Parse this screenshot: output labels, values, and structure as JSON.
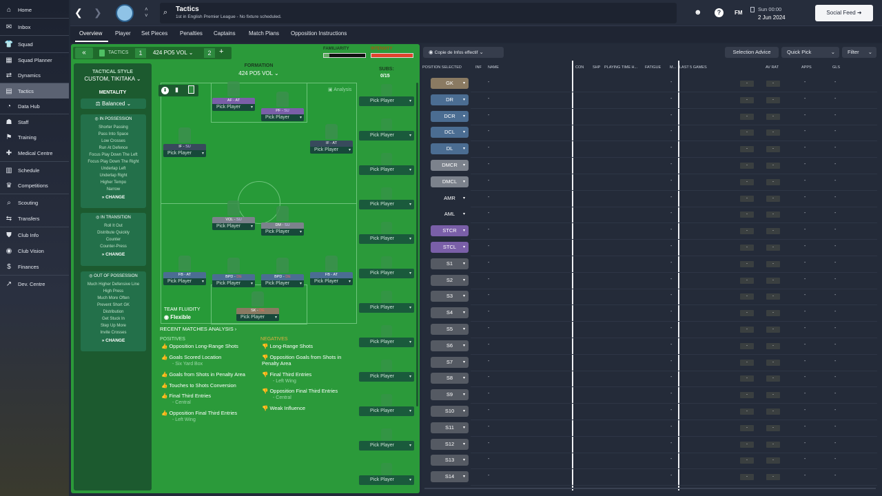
{
  "sidebar": {
    "items": [
      {
        "label": "Home",
        "icon": "home-icon",
        "g": "⌂"
      },
      {
        "label": "Inbox",
        "icon": "inbox-icon",
        "g": "✉",
        "badge": "123"
      },
      {
        "label": "Squad",
        "icon": "squad-icon",
        "g": "👕"
      },
      {
        "label": "Squad Planner",
        "icon": "planner-icon",
        "g": "▦"
      },
      {
        "label": "Dynamics",
        "icon": "dynamics-icon",
        "g": "⇄"
      },
      {
        "label": "Tactics",
        "icon": "tactics-icon",
        "g": "▤",
        "active": true
      },
      {
        "label": "Data Hub",
        "icon": "datahub-icon",
        "g": "◔"
      },
      {
        "label": "Staff",
        "icon": "staff-icon",
        "g": "☗"
      },
      {
        "label": "Training",
        "icon": "training-icon",
        "g": "⚑"
      },
      {
        "label": "Medical Centre",
        "icon": "medical-icon",
        "g": "✚"
      },
      {
        "label": "Schedule",
        "icon": "schedule-icon",
        "g": "▥"
      },
      {
        "label": "Competitions",
        "icon": "trophy-icon",
        "g": "♛"
      },
      {
        "label": "Scouting",
        "icon": "scouting-icon",
        "g": "⌕"
      },
      {
        "label": "Transfers",
        "icon": "transfers-icon",
        "g": "⇆"
      },
      {
        "label": "Club Info",
        "icon": "clubinfo-icon",
        "g": "⛊"
      },
      {
        "label": "Club Vision",
        "icon": "vision-icon",
        "g": "◉"
      },
      {
        "label": "Finances",
        "icon": "finances-icon",
        "g": "$"
      },
      {
        "label": "Dev. Centre",
        "icon": "devcentre-icon",
        "g": "↗"
      }
    ]
  },
  "header": {
    "title": "Tactics",
    "subtitle": "1st in English Premier League - No fixture scheduled.",
    "date_day": "Sun 00:00",
    "date": "2 Jun 2024",
    "social": "Social Feed",
    "fm": "FM"
  },
  "tabs": [
    "Overview",
    "Player",
    "Set Pieces",
    "Penalties",
    "Captains",
    "Match Plans",
    "Opposition Instructions"
  ],
  "tacticbar": {
    "label": "TACTICS",
    "slot1": "1",
    "name": "424 PO5 VOL",
    "slot2": "2",
    "add": "+",
    "familiarity": "FAMILIARITY",
    "intensity": "INTENSITY"
  },
  "style": {
    "heading": "TACTICAL STYLE",
    "value": "CUSTOM, TIKITAKA",
    "mentality_h": "MENTALITY",
    "mentality": "Balanced"
  },
  "in_possession": {
    "title": "IN POSSESSION",
    "items": [
      "Shorter Passing",
      "Pass Into Space",
      "Low Crosses",
      "Run At Defence",
      "Focus Play Down The Left",
      "Focus Play Down The Right",
      "Underlap Left",
      "Underlap Right",
      "Higher Tempo",
      "Narrow"
    ],
    "change": "CHANGE"
  },
  "in_transition": {
    "title": "IN TRANSITION",
    "items": [
      "Roll It Out",
      "Distribute Quickly",
      "Counter",
      "Counter-Press"
    ],
    "change": "CHANGE"
  },
  "out_possession": {
    "title": "OUT OF POSSESSION",
    "items": [
      "Much Higher Defensive Line",
      "High Press",
      "Much More Often",
      "Prevent Short GK",
      "Distribution",
      "Get Stuck In",
      "Step Up More",
      "Invite Crosses"
    ],
    "change": "CHANGE"
  },
  "formation": {
    "label": "FORMATION",
    "name": "424 PO5 VOL",
    "analysis": "Analysis",
    "subs_h": "SUBS:",
    "subs": "0/15"
  },
  "pitch_players": [
    {
      "role": "AF",
      "duty": "AT",
      "pick": "Pick Player",
      "c": "#7a5fa8"
    },
    {
      "role": "PF",
      "duty": "SU",
      "pick": "Pick Player",
      "c": "#7a5fa8"
    },
    {
      "role": "IF",
      "duty": "SU",
      "pick": "Pick Player",
      "c": "#384a5c"
    },
    {
      "role": "IF",
      "duty": "AT",
      "pick": "Pick Player",
      "c": "#384a5c"
    },
    {
      "role": "VOL",
      "duty": "SU",
      "pick": "Pick Player",
      "c": "#7c828c"
    },
    {
      "role": "DM",
      "duty": "SU",
      "pick": "Pick Player",
      "c": "#7c828c"
    },
    {
      "role": "FB",
      "duty": "AT",
      "pick": "Pick Player",
      "c": "#4b6d92"
    },
    {
      "role": "BPD",
      "duty": "DE",
      "pick": "Pick Player",
      "c": "#4b6d92"
    },
    {
      "role": "BPD",
      "duty": "DE",
      "pick": "Pick Player",
      "c": "#4b6d92"
    },
    {
      "role": "FB",
      "duty": "AT",
      "pick": "Pick Player",
      "c": "#4b6d92"
    },
    {
      "role": "SK",
      "duty": "DE",
      "pick": "Pick Player",
      "c": "#8a7a62"
    }
  ],
  "fluidity": {
    "label": "TEAM FLUIDITY",
    "value": "Flexible"
  },
  "sub_pick": "Pick Player",
  "analysis": {
    "title": "RECENT MATCHES ANALYSIS",
    "pos_h": "POSITIVES",
    "neg_h": "NEGATIVES",
    "positives": [
      [
        "Opposition Long-Range Shots",
        ""
      ],
      [
        "Goals Scored Location",
        "- Six Yard Box"
      ],
      [
        "Goals from Shots in Penalty Area",
        ""
      ],
      [
        "Touches to Shots Conversion",
        ""
      ],
      [
        "Final Third Entries",
        "- Central"
      ],
      [
        "Opposition Final Third Entries",
        "- Left Wing"
      ]
    ],
    "negatives": [
      [
        "Long-Range Shots",
        ""
      ],
      [
        "Opposition Goals from Shots in Penalty Area",
        ""
      ],
      [
        "Final Third Entries",
        "- Left Wing"
      ],
      [
        "Opposition Final Third Entries",
        "- Central"
      ],
      [
        "Weak Influence",
        ""
      ]
    ]
  },
  "right": {
    "copy": "Copie de Infos effectif",
    "selection": "Selection Advice",
    "quick": "Quick Pick",
    "filter": "Filter",
    "cols": [
      "POSITION SELECTED",
      "INF",
      "NAME",
      "CON",
      "SHP",
      "PLAYING TIME H...",
      "FATIGUE",
      "M...",
      "LAST 5 GAMES",
      "AV RAT",
      "APPS",
      "GLS"
    ],
    "positions": [
      [
        "GK",
        "#8a7a62"
      ],
      [
        "DR",
        "#4b6d92"
      ],
      [
        "DCR",
        "#4b6d92"
      ],
      [
        "DCL",
        "#4b6d92"
      ],
      [
        "DL",
        "#4b6d92"
      ],
      [
        "DMCR",
        "#7c828c"
      ],
      [
        "DMCL",
        "#7c828c"
      ],
      [
        "AMR",
        ""
      ],
      [
        "AML",
        ""
      ],
      [
        "STCR",
        "#7a5fa8"
      ],
      [
        "STCL",
        "#7a5fa8"
      ],
      [
        "S1",
        "#555a63"
      ],
      [
        "S2",
        "#555a63"
      ],
      [
        "S3",
        "#555a63"
      ],
      [
        "S4",
        "#555a63"
      ],
      [
        "S5",
        "#555a63"
      ],
      [
        "S6",
        "#555a63"
      ],
      [
        "S7",
        "#555a63"
      ],
      [
        "S8",
        "#555a63"
      ],
      [
        "S9",
        "#555a63"
      ],
      [
        "S10",
        "#555a63"
      ],
      [
        "S11",
        "#555a63"
      ],
      [
        "S12",
        "#555a63"
      ],
      [
        "S13",
        "#555a63"
      ],
      [
        "S14",
        "#555a63"
      ]
    ],
    "dash": "-"
  }
}
